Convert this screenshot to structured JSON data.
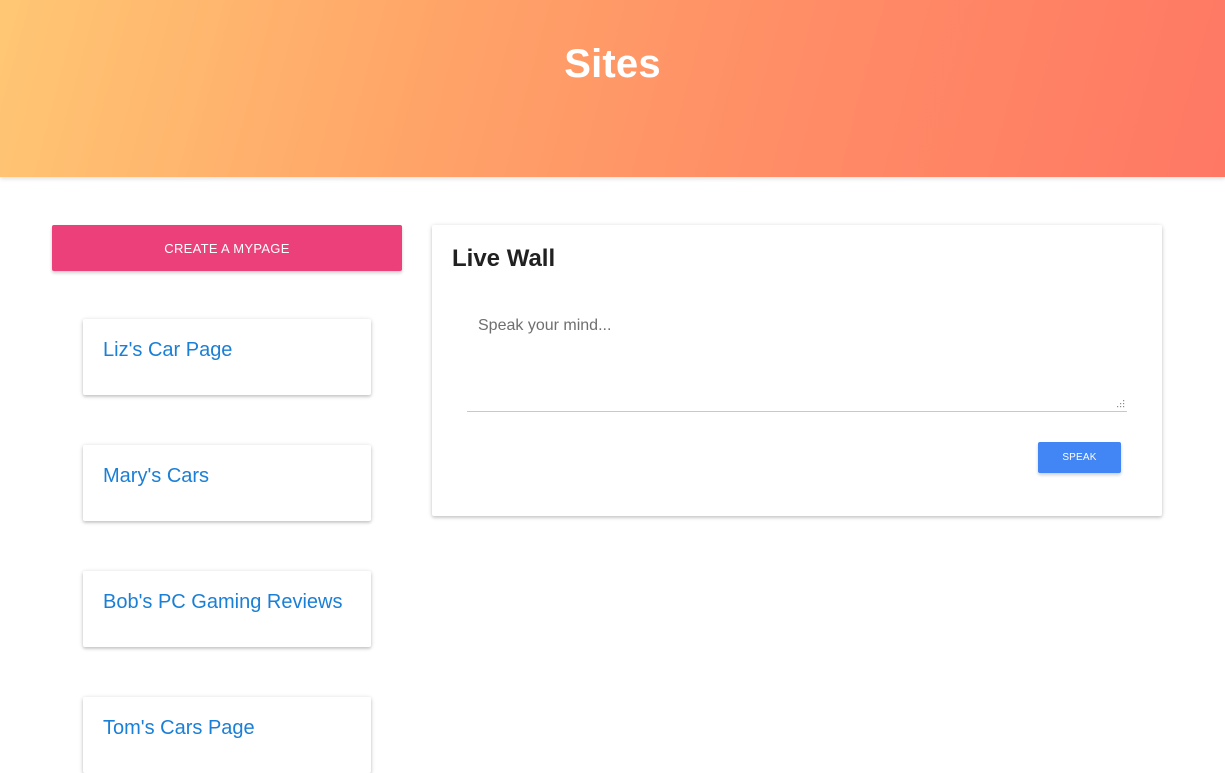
{
  "header": {
    "title": "Sites"
  },
  "sidebar": {
    "create_button_label": "CREATE A MYPAGE",
    "sites": [
      {
        "label": "Liz's Car Page"
      },
      {
        "label": "Mary's Cars"
      },
      {
        "label": "Bob's PC Gaming Reviews"
      },
      {
        "label": "Tom's Cars Page"
      }
    ]
  },
  "live_wall": {
    "title": "Live Wall",
    "input_placeholder": "Speak your mind...",
    "input_value": "",
    "submit_label": "SPEAK"
  },
  "colors": {
    "header_gradient_start": "#ffc774",
    "header_gradient_end": "#ff7864",
    "create_button": "#ec407a",
    "speak_button": "#4285f4",
    "link": "#1a7fd6"
  }
}
